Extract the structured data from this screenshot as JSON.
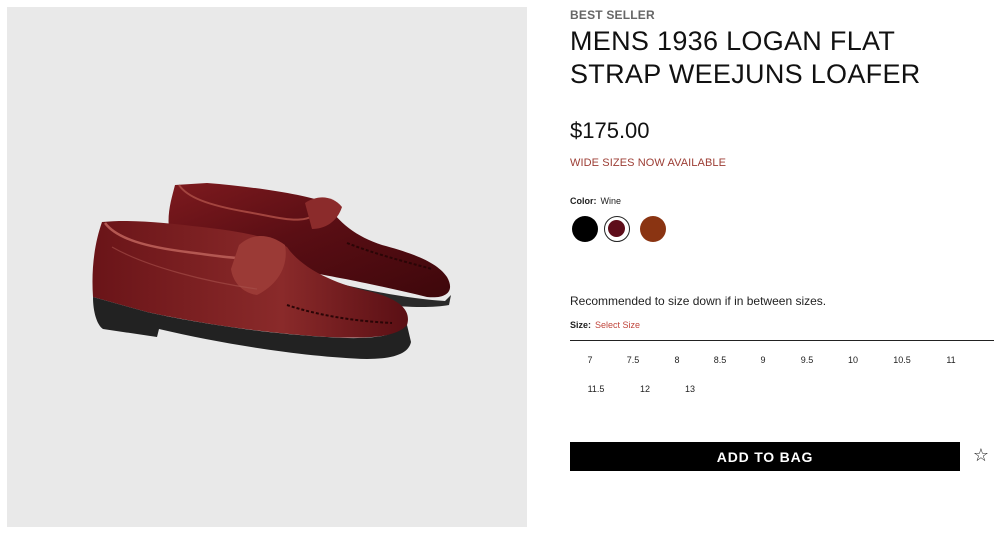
{
  "product": {
    "badge": "BEST SELLER",
    "title": "MENS 1936 LOGAN FLAT STRAP WEEJUNS LOAFER",
    "price": "$175.00",
    "wide_sizes_note": "WIDE SIZES NOW AVAILABLE"
  },
  "color": {
    "label": "Color:",
    "selected": "Wine",
    "swatches": [
      {
        "name": "Black",
        "hex": "#000000",
        "selected": false
      },
      {
        "name": "Wine",
        "hex": "#5e0d1a",
        "selected": true
      },
      {
        "name": "Brown",
        "hex": "#8a3412",
        "selected": false
      }
    ]
  },
  "size": {
    "note": "Recommended to size down if in between sizes.",
    "label": "Size:",
    "selected_text": "Select Size",
    "options": [
      "7",
      "7.5",
      "8",
      "8.5",
      "9",
      "9.5",
      "10",
      "10.5",
      "11",
      "11.5",
      "12",
      "13"
    ]
  },
  "actions": {
    "add_to_bag": "ADD TO BAG",
    "wishlist_icon": "star-outline-icon"
  },
  "colors": {
    "image_background": "#e9e9e9",
    "note_red": "#9c3d34",
    "select_red": "#c0463c",
    "button_black": "#000000"
  }
}
